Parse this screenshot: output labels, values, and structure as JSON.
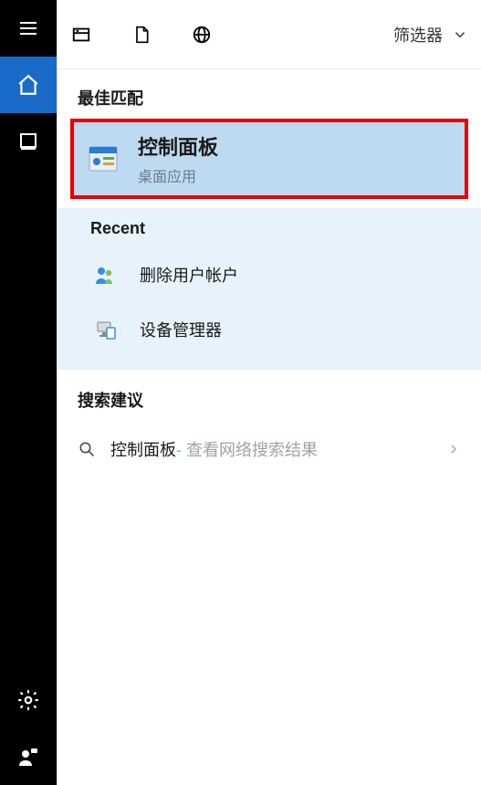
{
  "topbar": {
    "filter_label": "筛选器"
  },
  "best_match": {
    "header": "最佳匹配",
    "title": "控制面板",
    "subtitle": "桌面应用"
  },
  "recent": {
    "header": "Recent",
    "items": [
      {
        "label": "删除用户帐户",
        "icon": "users-icon"
      },
      {
        "label": "设备管理器",
        "icon": "device-icon"
      }
    ]
  },
  "suggest": {
    "header": "搜索建议",
    "query": "控制面板",
    "tail": " - 查看网络搜索结果"
  }
}
